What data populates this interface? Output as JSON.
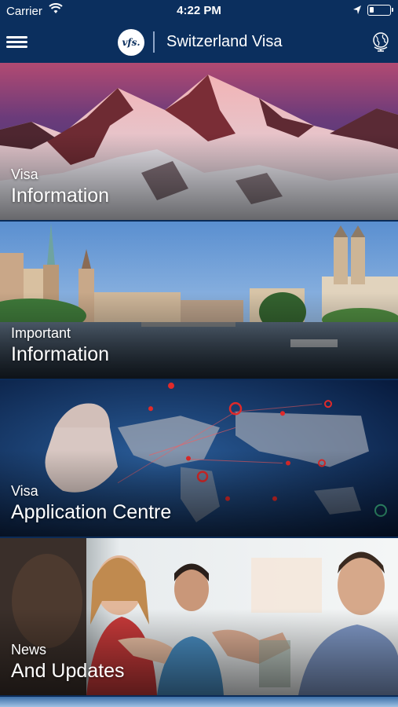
{
  "status_bar": {
    "carrier": "Carrier",
    "time": "4:22 PM",
    "battery_level": 0.2
  },
  "nav": {
    "logo_text": "vfs.",
    "title": "Switzerland Visa"
  },
  "tiles": [
    {
      "small": "Visa",
      "large": "Information"
    },
    {
      "small": "Important",
      "large": "Information"
    },
    {
      "small": "Visa",
      "large": "Application Centre"
    },
    {
      "small": "News",
      "large": "And Updates"
    }
  ],
  "colors": {
    "nav_background": "#0b2f5e",
    "text": "#ffffff"
  }
}
